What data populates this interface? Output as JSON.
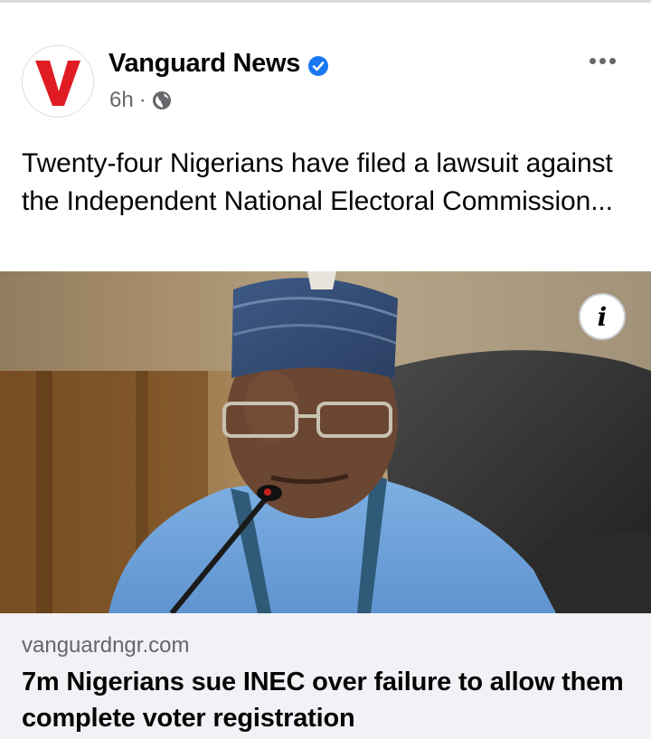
{
  "page": {
    "name": "Vanguard News",
    "verified": true,
    "time": "6h",
    "separator": "·",
    "privacy_icon": "globe-icon",
    "logo_letter": "V"
  },
  "header": {
    "more_icon": "more-options-icon"
  },
  "post": {
    "text": "Twenty-four Nigerians have filed a lawsuit against the Independent National Electoral Commission..."
  },
  "photo": {
    "info_label": "i"
  },
  "link_preview": {
    "domain": "vanguardngr.com",
    "title": "7m Nigerians sue INEC over failure to allow them complete voter registration"
  },
  "colors": {
    "brand_red": "#e01b22",
    "verified_blue": "#1877f2",
    "secondary_text": "#65676b",
    "link_bg": "#f0f2f5"
  }
}
